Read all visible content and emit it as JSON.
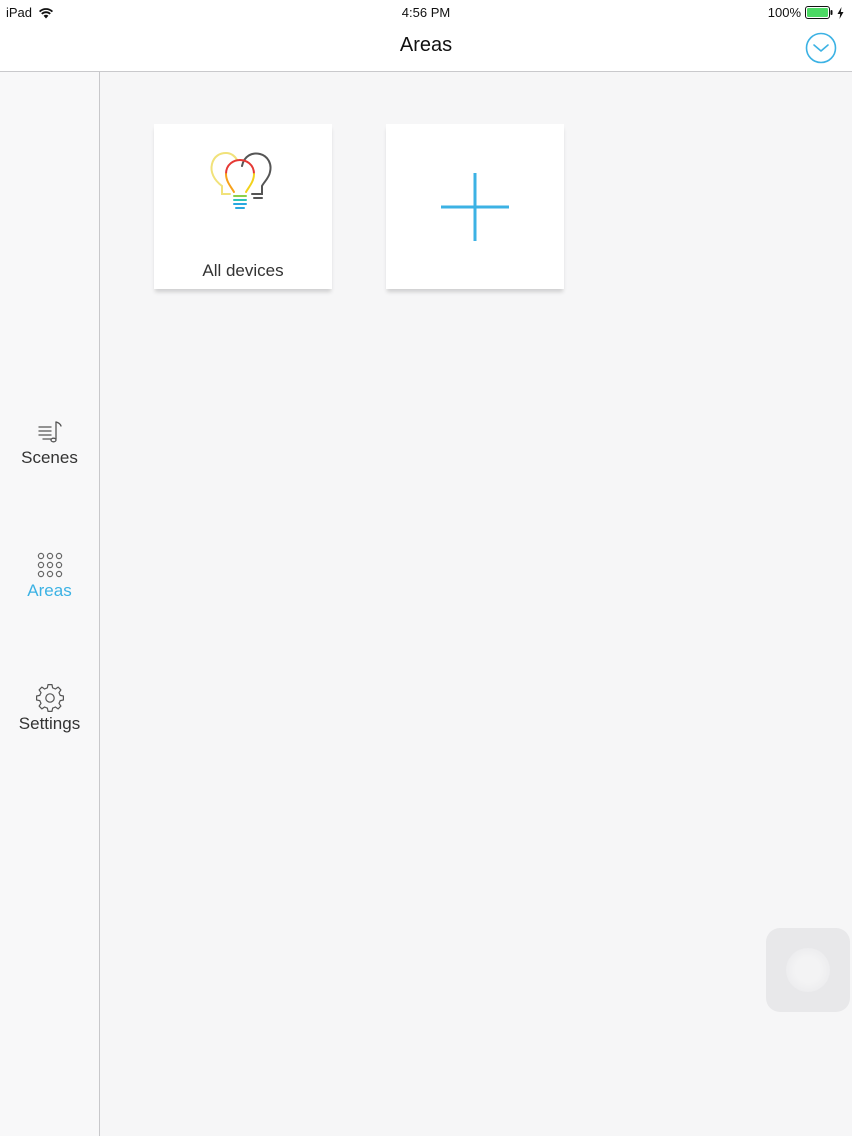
{
  "status_bar": {
    "device": "iPad",
    "time": "4:56 PM",
    "battery": "100%"
  },
  "nav": {
    "title": "Areas",
    "action_icon": "chevron-down-circle-icon"
  },
  "sidebar": {
    "items": [
      {
        "label": "Scenes",
        "icon": "scenes-icon",
        "active": false
      },
      {
        "label": "Areas",
        "icon": "grid-dots-icon",
        "active": true
      },
      {
        "label": "Settings",
        "icon": "gear-icon",
        "active": false
      }
    ]
  },
  "areas": {
    "tiles": [
      {
        "label": "All devices",
        "icon": "light-bulbs-icon"
      },
      {
        "label": "",
        "icon": "plus-icon"
      }
    ]
  },
  "colors": {
    "accent": "#3cb2e4",
    "background": "#f6f6f7",
    "sidebar_active": "#3cb2e4"
  }
}
